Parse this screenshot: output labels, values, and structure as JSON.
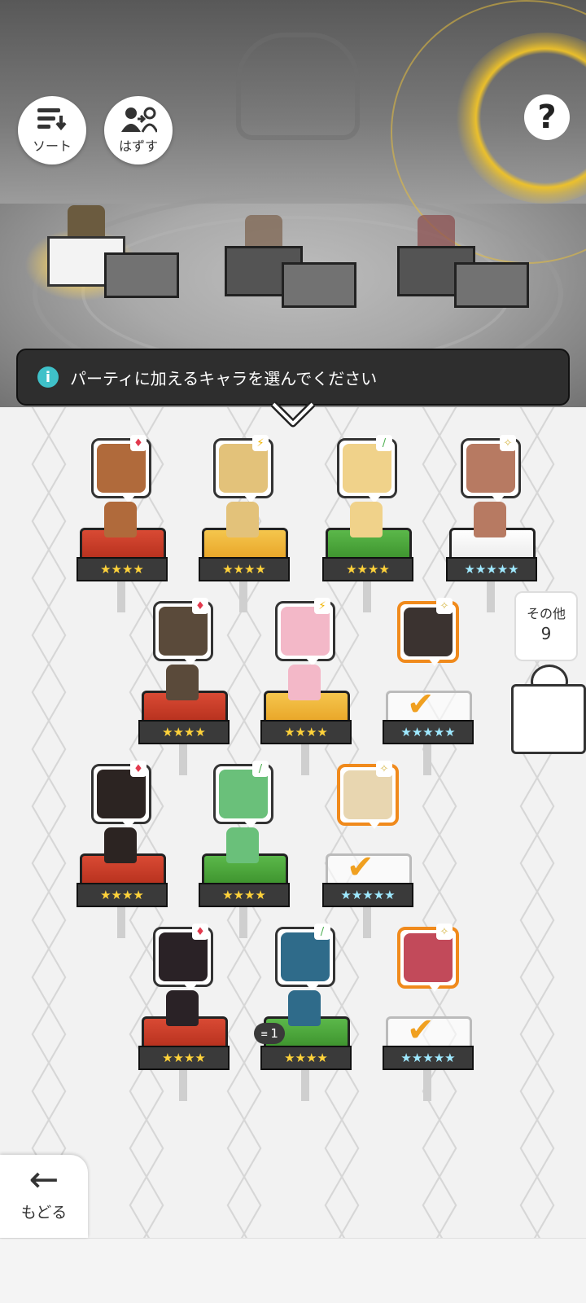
{
  "toolbar": {
    "sort_label": "ソート",
    "remove_label": "はずす",
    "help_symbol": "?"
  },
  "banner": {
    "info_symbol": "i",
    "message": "パーティに加えるキャラを選んでください"
  },
  "characters": [
    {
      "element": "fire",
      "element_symbol": "♦",
      "block_color": "red",
      "stars": "★★★★",
      "selected": false
    },
    {
      "element": "thunder",
      "element_symbol": "⚡",
      "block_color": "yellow",
      "stars": "★★★★",
      "selected": false
    },
    {
      "element": "wind",
      "element_symbol": "/",
      "block_color": "green",
      "stars": "★★★★",
      "selected": false
    },
    {
      "element": "light",
      "element_symbol": "✧",
      "block_color": "white",
      "stars": "★★★★★",
      "selected": false
    },
    {
      "element": "fire",
      "element_symbol": "♦",
      "block_color": "red",
      "stars": "★★★★",
      "selected": false
    },
    {
      "element": "thunder",
      "element_symbol": "⚡",
      "block_color": "yellow",
      "stars": "★★★★",
      "selected": false
    },
    {
      "element": "light",
      "element_symbol": "✧",
      "block_color": "ghost",
      "stars": "★★★★★",
      "selected": true
    },
    {
      "element": "fire",
      "element_symbol": "♦",
      "block_color": "red",
      "stars": "★★★★",
      "selected": false
    },
    {
      "element": "wind",
      "element_symbol": "/",
      "block_color": "green",
      "stars": "★★★★",
      "selected": false
    },
    {
      "element": "light",
      "element_symbol": "✧",
      "block_color": "ghost",
      "stars": "★★★★★",
      "selected": true
    },
    {
      "element": "fire",
      "element_symbol": "♦",
      "block_color": "red",
      "stars": "★★★★",
      "selected": false
    },
    {
      "element": "wind",
      "element_symbol": "/",
      "block_color": "green",
      "stars": "★★★★",
      "selected": false
    },
    {
      "element": "light",
      "element_symbol": "✧",
      "block_color": "ghost",
      "stars": "★★★★★",
      "selected": true
    }
  ],
  "others": {
    "label": "その他",
    "count": "9"
  },
  "party_badge": {
    "text": "1"
  },
  "back": {
    "label": "もどる"
  },
  "colors": {
    "selected_border": "#f08a1c",
    "check": "#f0a020",
    "banner_bg": "#2e2e2e",
    "info_icon": "#3fc1c9",
    "glow": "#f0c328"
  }
}
